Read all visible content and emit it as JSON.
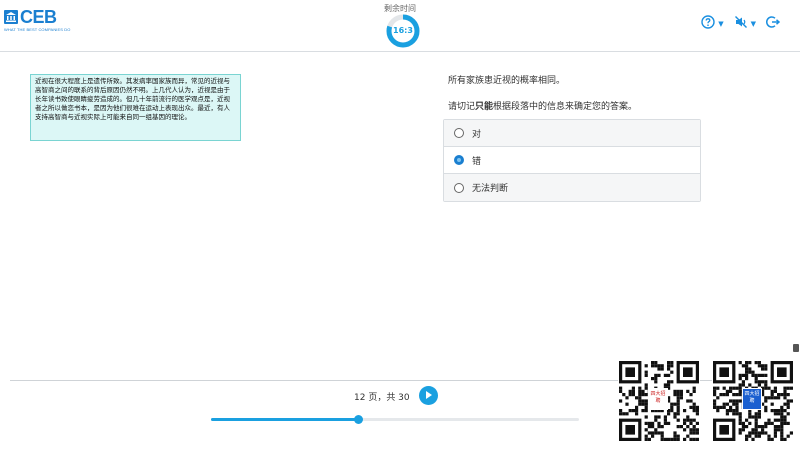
{
  "header": {
    "logo_text": "CEB",
    "logo_tagline": "WHAT THE BEST COMPANIES DO",
    "timer_label": "剩余时间",
    "timer_value": "16:3",
    "timer_remaining_fraction": 0.8
  },
  "icons": {
    "help": "help-circle-icon",
    "mute": "mute-icon",
    "exit": "exit-icon"
  },
  "passage": {
    "text": "近视在很大程度上是遗传所致。其发病率国家族而异，常见的近视与高智商之间的联系的背后原因仍然不明。上几代人认为，近视是由于长年读书致使眼睛疲劳造成的。但几十年前流行的医学观点是，近视者之所以做恋书本，是因为他们很难在运动上表现出众。最近，有人支持高智商与近视实际上可能来自同一组基因的理论。"
  },
  "question": {
    "statement": "所有家族患近视的概率相同。",
    "instruction_pre": "请切记",
    "instruction_bold": "只能",
    "instruction_post": "根据段落中的信息来确定您的答案。",
    "options": [
      {
        "label": "对",
        "selected": false
      },
      {
        "label": "错",
        "selected": true
      },
      {
        "label": "无法判断",
        "selected": false
      }
    ]
  },
  "footer": {
    "pager_text": "12 页，共 30",
    "progress": 0.4
  },
  "qr_left": {
    "badge": "四大招聘"
  },
  "qr_right": {
    "badge": "四大招聘"
  },
  "colors": {
    "accent": "#1aa0e0",
    "brand": "#1a7fd0",
    "passage_bg": "#dcf7f6"
  }
}
